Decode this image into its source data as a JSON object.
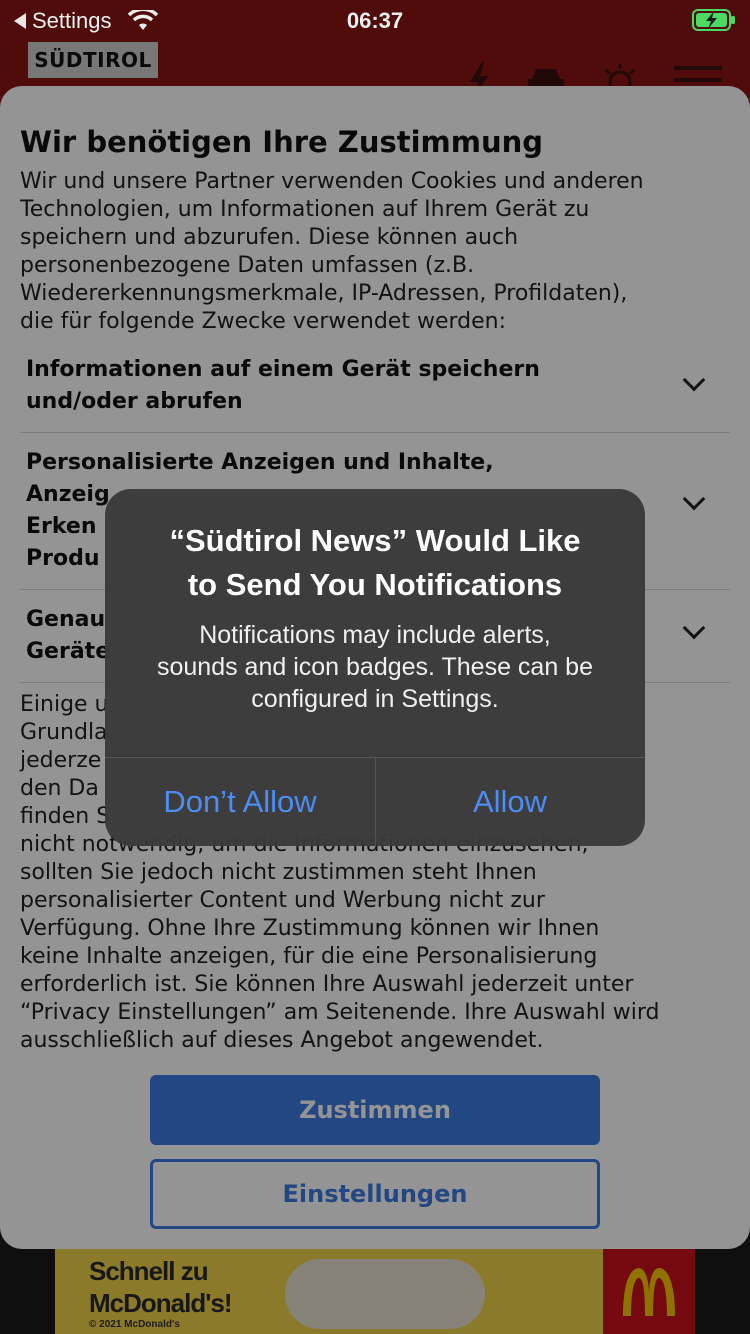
{
  "status_bar": {
    "back_label": "Settings",
    "time": "06:37"
  },
  "app_header": {
    "brand": "SÜDTIROL"
  },
  "consent": {
    "title": "Wir benötigen Ihre Zustimmung",
    "body": "Wir und unsere Partner verwenden Cookies und anderen\nTechnologien, um Informationen auf Ihrem Gerät zu\nspeichern und abzurufen. Diese können auch\npersonenbezogene Daten umfassen (z.B.\nWiedererkennungsmerkmale, IP-Adressen, Profildaten),\ndie für folgende Zwecke verwendet werden:",
    "purposes": [
      {
        "label": "Informationen auf einem Gerät speichern\nund/oder abrufen"
      },
      {
        "label": "Personalisierte Anzeigen und Inhalte,\nAnzeig\nErken\nProdu"
      },
      {
        "label": "Genau\nGeräte"
      }
    ],
    "details": "Einige u\nGrundla\njederze\nden Da\nfinden S\nnicht notwendig, um die Informationen einzusehen,\nsollten Sie jedoch nicht zustimmen steht Ihnen\npersonalisierter Content und Werbung nicht zur\nVerfügung. Ohne Ihre Zustimmung können wir Ihnen\nkeine Inhalte anzeigen, für die eine Personalisierung\nerforderlich ist. Sie können Ihre Auswahl jederzeit unter\n“Privacy Einstellungen” am Seitenende. Ihre Auswahl wird\nausschließlich auf dieses Angebot angewendet.",
    "accept_label": "Zustimmen",
    "settings_label": "Einstellungen"
  },
  "ad": {
    "headline": "Schnell zu\nMcDonald's!",
    "copyright": "© 2021 McDonald's"
  },
  "alert": {
    "title": "“Südtirol News” Would Like\nto Send You Notifications",
    "message": "Notifications may include alerts,\nsounds and icon badges. These can be\nconfigured in Settings.",
    "deny_label": "Don’t Allow",
    "allow_label": "Allow"
  },
  "colors": {
    "header_red": "#8b1414",
    "consent_blue": "#3d7ae0",
    "alert_button_blue": "#4b8df5",
    "battery_green": "#4cd964"
  }
}
